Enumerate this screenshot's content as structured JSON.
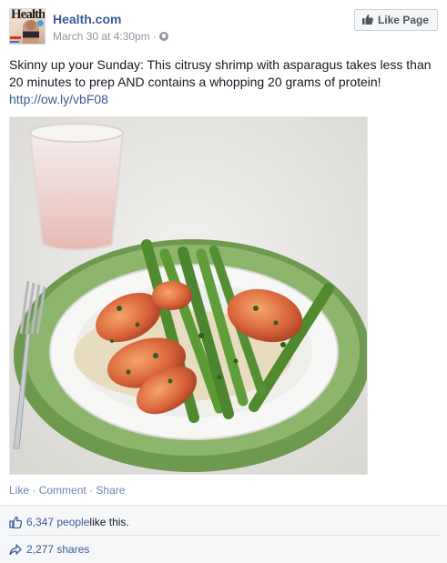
{
  "post": {
    "page_name": "Health.com",
    "timestamp": "March 30 at 4:30pm",
    "meta_separator": "·",
    "avatar_text": "Health",
    "like_page_label": "Like Page",
    "text": "Skinny up your Sunday: This citrusy shrimp with asparagus takes less than 20 minutes to prep AND contains a whopping 20 grams of protein!",
    "link": "http://ow.ly/vbF08"
  },
  "actions": {
    "like": "Like",
    "comment": "Comment",
    "share": "Share",
    "separator": "·"
  },
  "feedback": {
    "likes_count": "6,347 people",
    "likes_suffix": " like this.",
    "shares_count": "2,277 shares"
  },
  "icons": {
    "like_page": "thumbs-up-icon",
    "privacy": "globe-icon",
    "likes": "thumbs-up-outline-icon",
    "shares": "share-arrow-icon"
  },
  "colors": {
    "link_blue": "#3b5998",
    "meta_gray": "#9197a3",
    "plate_green": "#6e9a4f",
    "feedback_bg": "#f6f7f9"
  }
}
